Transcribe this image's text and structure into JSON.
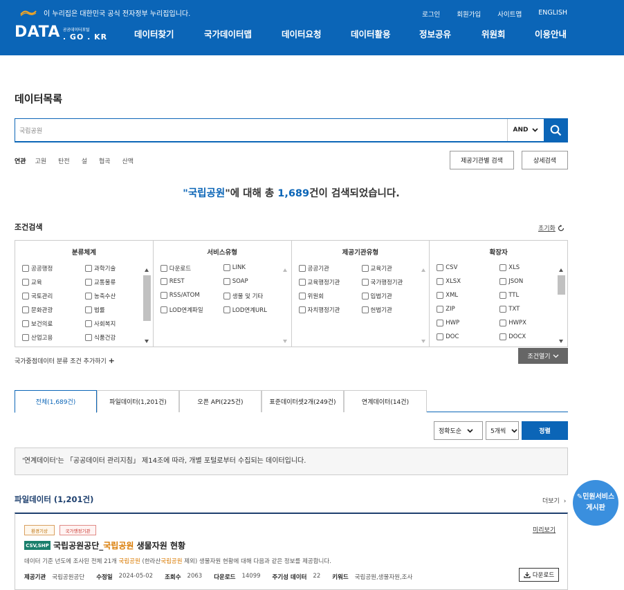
{
  "header": {
    "gov_notice": "이 누리집은 대한민국 공식 전자정부 누리집입니다.",
    "util_links": [
      "로그인",
      "회원가입",
      "사이트맵",
      "ENGLISH"
    ],
    "logo_main": "DATA",
    "logo_sub": "공공데이터포털",
    "logo_domain": ". GO . KR",
    "nav": [
      "데이터찾기",
      "국가데이터맵",
      "데이터요청",
      "데이터활용",
      "정보공유",
      "위원회",
      "이용안내"
    ]
  },
  "page_title": "데이터목록",
  "search": {
    "value": "국립공원",
    "operator": "AND"
  },
  "related": {
    "label": "연관",
    "keywords": [
      "고원",
      "탄전",
      "설",
      "협곡",
      "산맥"
    ]
  },
  "buttons": {
    "provider_search": "제공기관별 검색",
    "detail_search": "상세검색"
  },
  "result": {
    "prefix": "\"",
    "query": "국립공원",
    "mid": "\"에 대해 총 ",
    "count": "1,689",
    "suffix": "건이 검색되었습니다."
  },
  "conditions": {
    "title": "조건검색",
    "reset": "초기화",
    "columns": [
      {
        "title": "분류체계",
        "items": [
          "공공행정",
          "과학기술",
          "교육",
          "교통물류",
          "국토관리",
          "농축수산",
          "문화관광",
          "법률",
          "보건의료",
          "사회복지",
          "산업고용",
          "식품건강"
        ],
        "scroll": true
      },
      {
        "title": "서비스유형",
        "items": [
          "다운로드",
          "LINK",
          "REST",
          "SOAP",
          "RSS/ATOM",
          "생물 및 기타",
          "LOD연계파일",
          "LOD연계URL"
        ],
        "scroll": false
      },
      {
        "title": "제공기관유형",
        "items": [
          "공공기관",
          "교육기관",
          "교육행정기관",
          "국가행정기관",
          "위원회",
          "입법기관",
          "자치행정기관",
          "헌법기관"
        ],
        "scroll": false
      },
      {
        "title": "확장자",
        "items": [
          "CSV",
          "XLS",
          "XLSX",
          "JSON",
          "XML",
          "TTL",
          "ZIP",
          "TXT",
          "HWP",
          "HWPX",
          "DOC",
          "DOCX"
        ],
        "scroll": true
      }
    ],
    "add_condition": "국가중점데이터 분류 조건 추가하기",
    "open": "조건열기"
  },
  "tabs": [
    {
      "label": "전체(1,689건)",
      "active": true
    },
    {
      "label": "파일데이터(1,201건)",
      "active": false
    },
    {
      "label": "오픈 API(225건)",
      "active": false
    },
    {
      "label": "표준데이터셋2개(249건)",
      "active": false
    },
    {
      "label": "연계데이터(14건)",
      "active": false
    }
  ],
  "sort": {
    "order": "정확도순",
    "per_page": "5개씩",
    "apply": "정렬"
  },
  "notice": "'연계데이터'는 「공공데이터 관리지침」 제14조에 따라, 개별 포털로부터 수집되는 데이터입니다.",
  "file_section": {
    "title": "파일데이터 (1,201건)",
    "more": "더보기"
  },
  "card": {
    "badges": [
      "환경기상",
      "국가행정기관"
    ],
    "preview": "미리보기",
    "format": "CSV,SHP",
    "title_pre": "국립공원공단_",
    "title_hl": "국립공원",
    "title_post": " 생물자원 현황",
    "desc_1": "데이터 기준 년도에 조사된 전체 21개 ",
    "desc_hl1": "국립공원",
    "desc_2": " (한라산",
    "desc_hl2": "국립공원",
    "desc_3": " 제외) 생물자원 현황에 대해 다음과 같은 정보를 제공합니다.",
    "meta": {
      "provider_label": "제공기관",
      "provider": "국립공원공단",
      "modified_label": "수정일",
      "modified": "2024-05-02",
      "views_label": "조회수",
      "views": "2063",
      "downloads_label": "다운로드",
      "downloads": "14099",
      "periodic_label": "주기성 데이터",
      "periodic": "22",
      "keyword_label": "키워드",
      "keyword": "국립공원,생물자원,조사"
    },
    "download": "다운로드"
  },
  "civil": {
    "line1": "민원서비스",
    "line2": "게시판"
  },
  "colors": {
    "primary": "#0b65b7",
    "highlight": "#d97a00",
    "format_badge": "#1a7f6c",
    "civil": "#3a8fde"
  }
}
